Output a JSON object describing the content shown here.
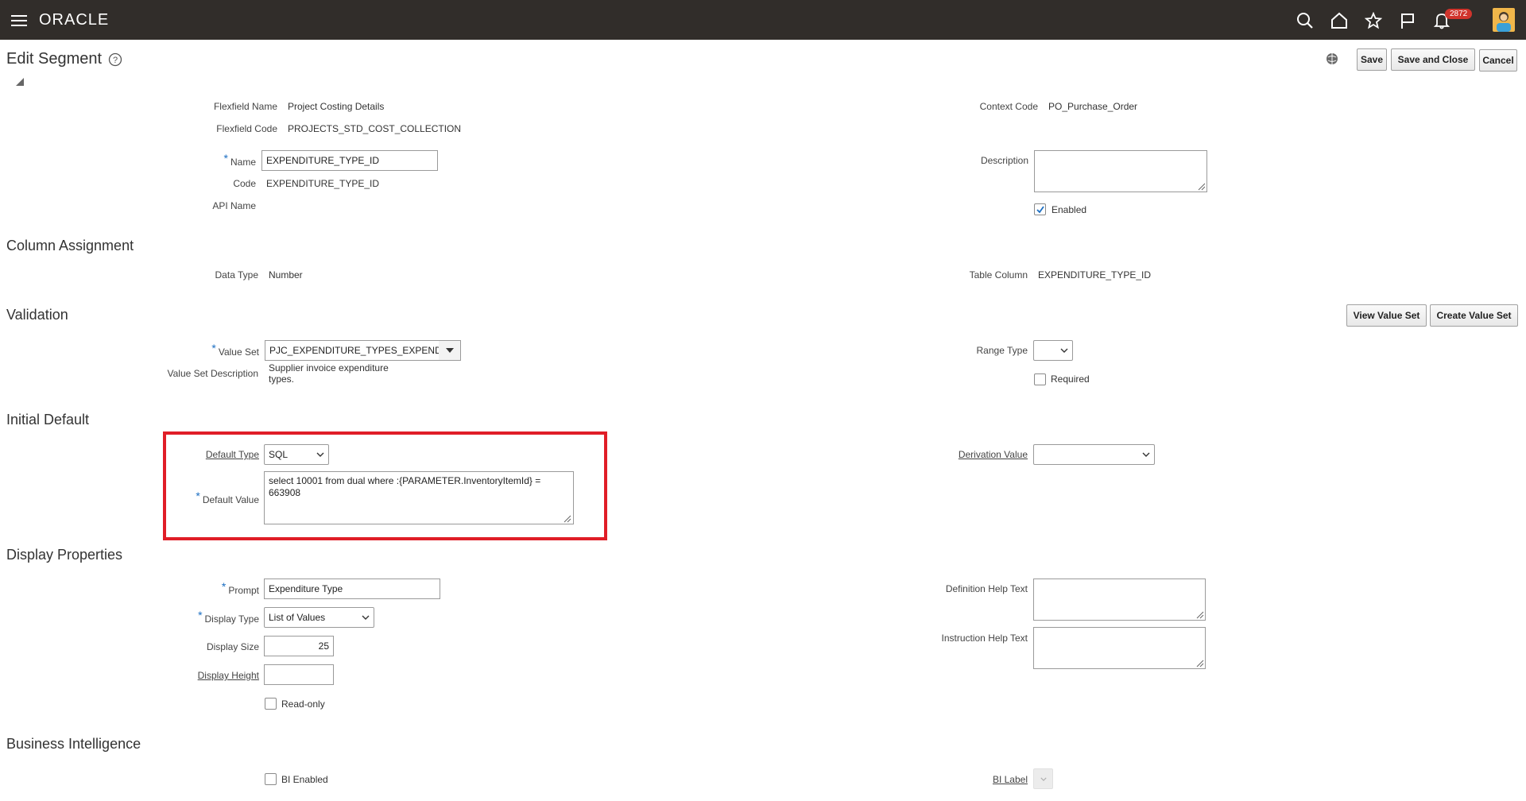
{
  "app": {
    "brand": "ORACLE",
    "notifications_count": "2872"
  },
  "header": {
    "title": "Edit Segment",
    "buttons": {
      "save": "Save",
      "save_and_close": "Save and Close",
      "cancel": "Cancel"
    }
  },
  "segment": {
    "flexfield_name_label": "Flexfield Name",
    "flexfield_name": "Project Costing Details",
    "flexfield_code_label": "Flexfield Code",
    "flexfield_code": "PROJECTS_STD_COST_COLLECTION",
    "context_code_label": "Context Code",
    "context_code": "PO_Purchase_Order",
    "name_label": "Name",
    "name": "EXPENDITURE_TYPE_ID",
    "code_label": "Code",
    "code": "EXPENDITURE_TYPE_ID",
    "api_name_label": "API Name",
    "description_label": "Description",
    "description": "",
    "enabled_label": "Enabled",
    "enabled": true
  },
  "column_assignment": {
    "title": "Column Assignment",
    "data_type_label": "Data Type",
    "data_type": "Number",
    "table_column_label": "Table Column",
    "table_column": "EXPENDITURE_TYPE_ID"
  },
  "validation": {
    "title": "Validation",
    "view_value_set": "View Value Set",
    "create_value_set": "Create Value Set",
    "value_set_label": "Value Set",
    "value_set": "PJC_EXPENDITURE_TYPES_EXPENDITURE_TYPES",
    "value_set_description_label": "Value Set Description",
    "value_set_description": "Supplier invoice expenditure types.",
    "range_type_label": "Range Type",
    "range_type": "",
    "required_label": "Required",
    "required": false
  },
  "initial_default": {
    "title": "Initial Default",
    "default_type_label": "Default Type",
    "default_type": "SQL",
    "default_value_label": "Default Value",
    "default_value": "select 10001 from dual where :{PARAMETER.InventoryItemId} = 663908",
    "derivation_value_label": "Derivation Value",
    "derivation_value": ""
  },
  "display_properties": {
    "title": "Display Properties",
    "prompt_label": "Prompt",
    "prompt": "Expenditure Type",
    "display_type_label": "Display Type",
    "display_type": "List of Values",
    "display_size_label": "Display Size",
    "display_size": "25",
    "display_height_label": "Display Height",
    "display_height": "",
    "read_only_label": "Read-only",
    "definition_help_text_label": "Definition Help Text",
    "instruction_help_text_label": "Instruction Help Text"
  },
  "business_intelligence": {
    "title": "Business Intelligence",
    "bi_enabled_label": "BI Enabled",
    "bi_label_label": "BI Label"
  },
  "colors": {
    "topbar": "#312d2a",
    "highlight": "#e01e27",
    "required": "#1b6ec2"
  }
}
